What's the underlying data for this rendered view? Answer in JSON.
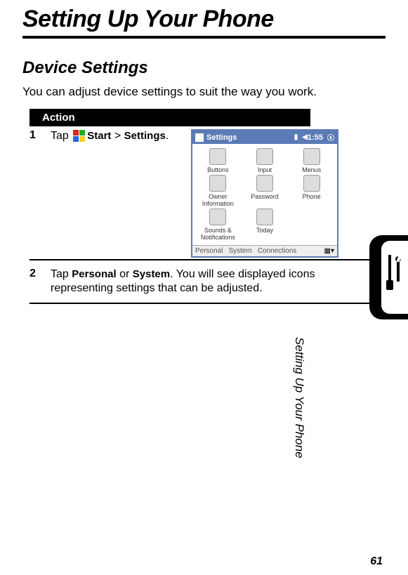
{
  "chapterTitle": "Setting Up Your Phone",
  "sectionTitle": "Device Settings",
  "intro": "You can adjust device settings to suit the way you work.",
  "actionHeader": "Action",
  "steps": {
    "s1": {
      "num": "1",
      "t1": "Tap ",
      "strongStart": "Start",
      "sep": " > ",
      "strongEnd": "Settings",
      "tail": "."
    },
    "s2": {
      "num": "2",
      "t1": "Tap ",
      "strongA": "Personal",
      "mid": " or ",
      "strongB": "System",
      "tail": ". You will see displayed icons representing settings that can be adjusted."
    }
  },
  "screenshot": {
    "title": "Settings",
    "time": "1:55",
    "cells": [
      "Buttons",
      "Input",
      "Menus",
      "Owner Information",
      "Password",
      "Phone",
      "Sounds & Notifications",
      "Today",
      ""
    ],
    "tabs": [
      "Personal",
      "System",
      "Connections"
    ]
  },
  "sideLabel": "Setting Up Your Phone",
  "pageNumber": "61"
}
